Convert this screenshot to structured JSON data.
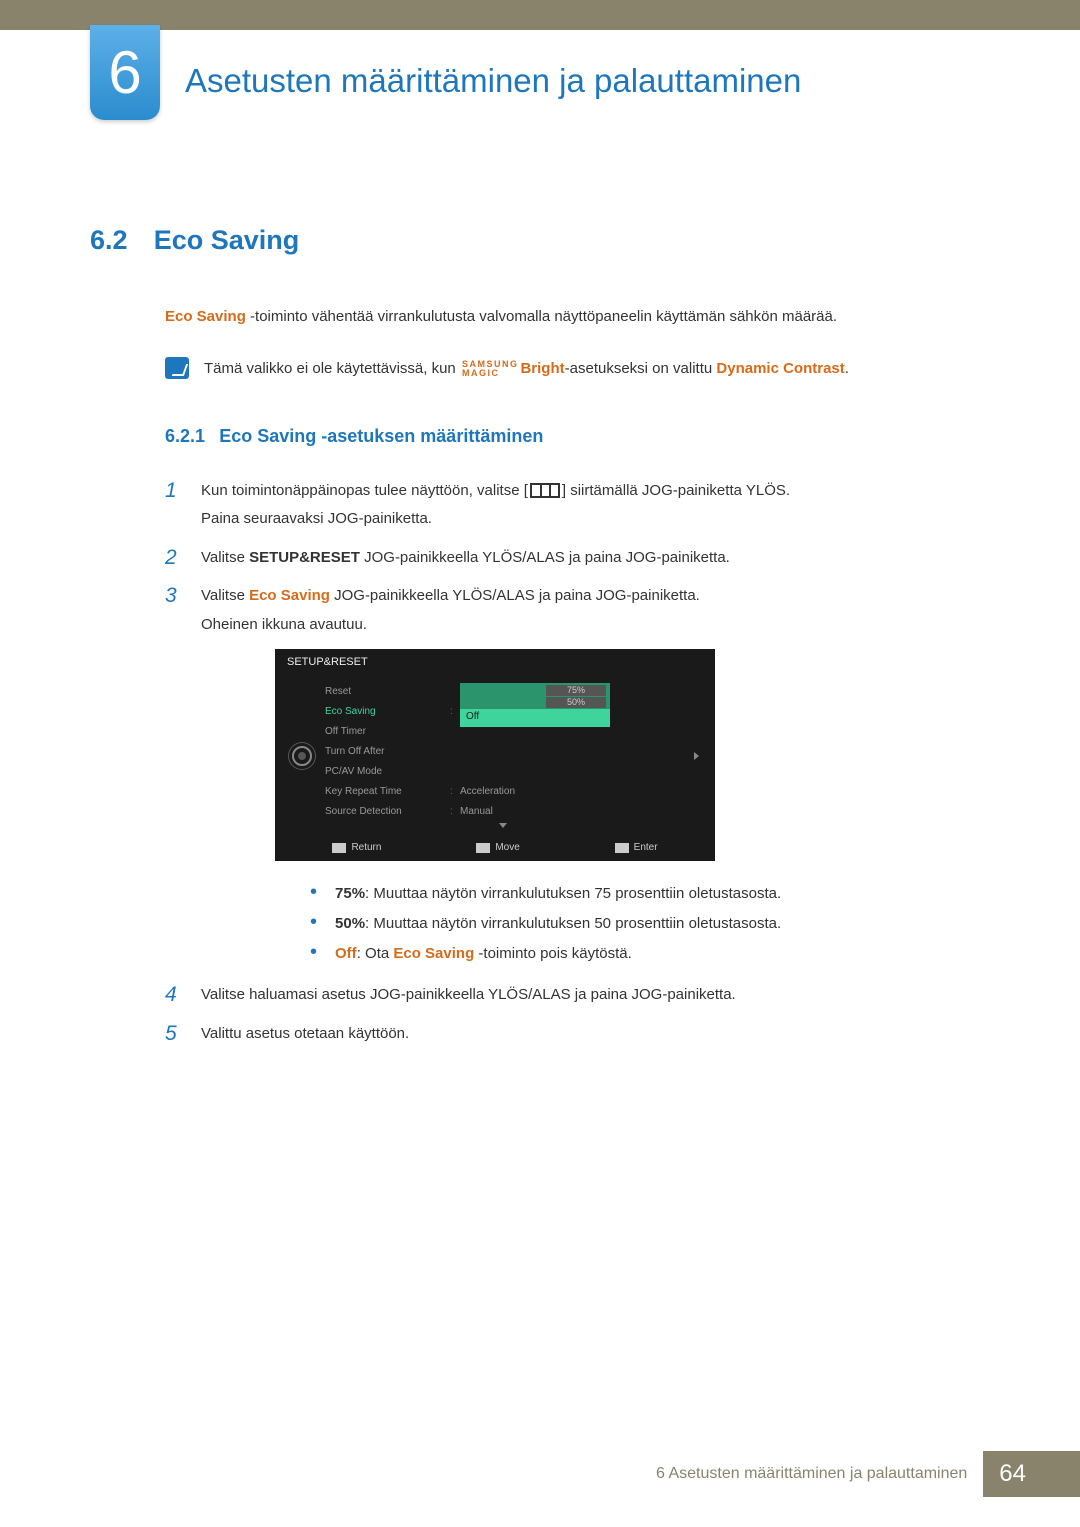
{
  "chapter": {
    "number": "6",
    "title": "Asetusten määrittäminen ja palauttaminen"
  },
  "section": {
    "number": "6.2",
    "title": "Eco Saving"
  },
  "intro": {
    "term": "Eco Saving",
    "desc": " -toiminto vähentää virrankulutusta valvomalla näyttöpaneelin käyttämän sähkön määrää."
  },
  "note": {
    "pre": "Tämä valikko ei ole käytettävissä, kun ",
    "brand_top": "SAMSUNG",
    "brand_bottom": "MAGIC",
    "brand_suffix": "Bright",
    "mid": "-asetukseksi on valittu ",
    "dyn": "Dynamic Contrast",
    "post": "."
  },
  "subsection": {
    "number": "6.2.1",
    "title": "Eco Saving -asetuksen määrittäminen"
  },
  "steps": {
    "s1": {
      "num": "1",
      "a": "Kun toimintonäppäinopas tulee näyttöön, valitse [",
      "b": "] siirtämällä JOG-painiketta YLÖS.",
      "c": "Paina seuraavaksi JOG-painiketta."
    },
    "s2": {
      "num": "2",
      "a": "Valitse ",
      "bold": "SETUP&RESET",
      "b": " JOG-painikkeella YLÖS/ALAS ja paina JOG-painiketta."
    },
    "s3": {
      "num": "3",
      "a": "Valitse ",
      "orange": "Eco Saving",
      "b": " JOG-painikkeella YLÖS/ALAS ja paina JOG-painiketta.",
      "c": "Oheinen ikkuna avautuu."
    },
    "s4": {
      "num": "4",
      "text": "Valitse haluamasi asetus JOG-painikkeella YLÖS/ALAS ja paina JOG-painiketta."
    },
    "s5": {
      "num": "5",
      "text": "Valittu asetus otetaan käyttöön."
    }
  },
  "osd": {
    "title": "SETUP&RESET",
    "items": {
      "reset": "Reset",
      "eco": "Eco Saving",
      "off_timer": "Off Timer",
      "turn_off": "Turn Off After",
      "pcav": "PC/AV Mode",
      "key_repeat": "Key Repeat Time",
      "src_detect": "Source Detection"
    },
    "values": {
      "opt75": "75%",
      "opt50": "50%",
      "selected": "Off",
      "accel": "Acceleration",
      "manual": "Manual"
    },
    "footer": {
      "return": "Return",
      "move": "Move",
      "enter": "Enter"
    }
  },
  "bullets": {
    "b1": {
      "label": "75%",
      "text": ": Muuttaa näytön virrankulutuksen 75 prosenttiin oletustasosta."
    },
    "b2": {
      "label": "50%",
      "text": ": Muuttaa näytön virrankulutuksen 50 prosenttiin oletustasosta."
    },
    "b3": {
      "label": "Off",
      "mid": ": Ota ",
      "eco": "Eco Saving",
      "text": " -toiminto pois käytöstä."
    }
  },
  "footer": {
    "text": "6 Asetusten määrittäminen ja palauttaminen",
    "page": "64"
  }
}
